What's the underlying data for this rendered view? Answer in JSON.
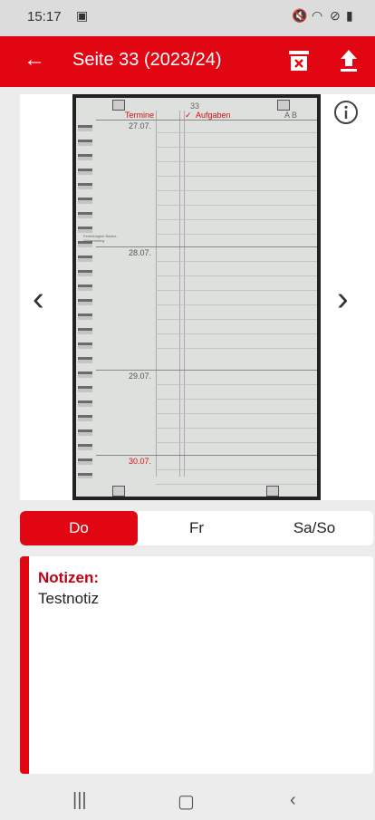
{
  "status": {
    "time": "15:17"
  },
  "appbar": {
    "title": "Seite 33 (2023/24)"
  },
  "page": {
    "page_number": "33",
    "col_termine": "Termine",
    "col_aufgaben": "Aufgaben",
    "col_ab": "A  B",
    "dates": [
      "27.07.",
      "28.07.",
      "29.07.",
      "30.07."
    ],
    "small_note": "Ferienbeginn Baden-Württemberg"
  },
  "tabs": [
    {
      "label": "Do",
      "active": true
    },
    {
      "label": "Fr",
      "active": false
    },
    {
      "label": "Sa/So",
      "active": false
    }
  ],
  "notes": {
    "label": "Notizen:",
    "text": "Testnotiz"
  },
  "colors": {
    "accent": "#e20613",
    "notes_label": "#c30012"
  },
  "icons": [
    "back-arrow-icon",
    "delete-archive-icon",
    "upload-icon",
    "info-icon",
    "chevron-left-icon",
    "chevron-right-icon"
  ]
}
